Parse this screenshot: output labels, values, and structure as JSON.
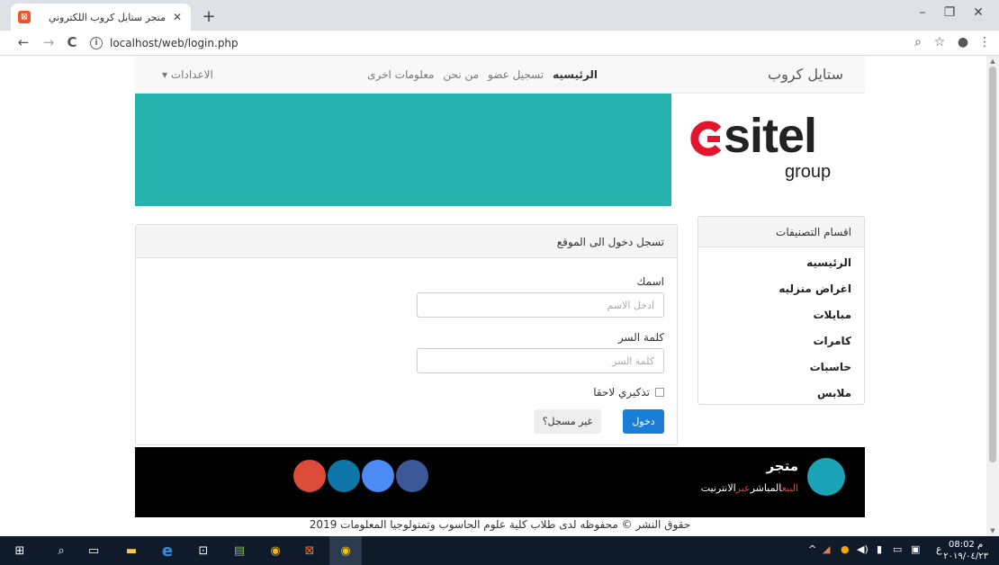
{
  "browser": {
    "tab_title": "متجر ستايل كروب اللكتروني",
    "favicon": "xampp-icon",
    "close_tab": "✕",
    "new_tab": "+",
    "url": "localhost/web/login.php",
    "window_controls": {
      "minimize": "–",
      "maximize": "❐",
      "close": "✕"
    },
    "nav": {
      "back": "←",
      "forward": "→",
      "reload": "C"
    }
  },
  "site": {
    "brand": "ستايل كروب",
    "nav_links": [
      "الرئيسيه",
      "تسجيل عضو",
      "من نحن",
      "معلومات اخرى"
    ],
    "settings": "الاعدادات ▾",
    "banner": {
      "logo_word": "sitel",
      "logo_sub": "group",
      "banner_color": "#26b3ad"
    },
    "sidebar": {
      "title": "اقسام التصنيفات",
      "items": [
        "الرئيسيه",
        "اغراض منزليه",
        "مبايلات",
        "كامرات",
        "حاسبات",
        "ملابس"
      ]
    },
    "login": {
      "title": "تسجل دخول الى الموقع",
      "name_label": "اسمك",
      "name_placeholder": "ادخل الاسم",
      "password_label": "كلمة السر",
      "password_placeholder": "كلمة السر",
      "remember": "تذكيري لاحقا",
      "login_button": "دخول",
      "register_button": "غير مسجل؟"
    },
    "footer": {
      "store_name": "متجر",
      "tagline_red1": "البيع",
      "tagline_white1": "المباشر",
      "tagline_red2": "عبر",
      "tagline_white2": "الانترنيت",
      "social_colors": [
        "#3b5998",
        "#4c8bf5",
        "#0e76a8",
        "#dd4b39"
      ]
    },
    "copyright": "حقوق النشر © محفوظه لدى طلاب كلية علوم الحاسوب وتمنولوجيا المعلومات 2019"
  },
  "taskbar": {
    "time": "08:02 م",
    "date": "٢٠١٩/٠٤/٢٣",
    "lang": "ع"
  }
}
